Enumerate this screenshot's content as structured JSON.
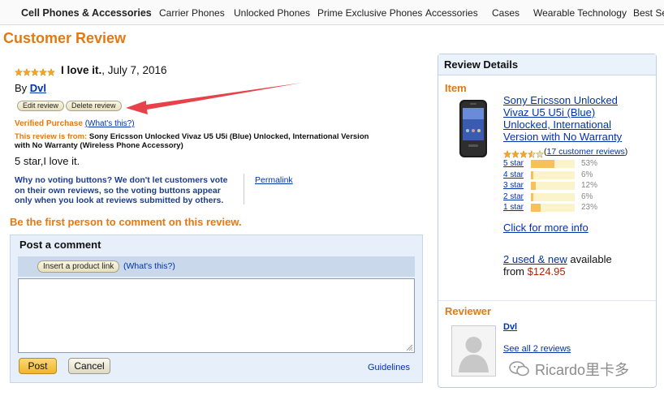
{
  "nav": {
    "items": [
      "Cell Phones & Accessories",
      "Carrier Phones",
      "Unlocked Phones",
      "Prime Exclusive Phones",
      "Accessories",
      "Cases",
      "Wearable Technology",
      "Best Se"
    ]
  },
  "page_title": "Customer Review",
  "review": {
    "rating": 5,
    "headline": "I love it.",
    "date": ", July 7, 2016",
    "by_label": "By",
    "author": "Dvl",
    "edit_label": "Edit review",
    "delete_label": "Delete review",
    "verified": "Verified Purchase",
    "whats_this": "(What's this?)",
    "from_label": "This review is from:",
    "product_name": "Sony Ericsson Unlocked Vivaz U5 U5i (Blue) Unlocked, International Version",
    "product_name_2": "with No Warranty (Wireless Phone Accessory)",
    "body": "5 star,I love it.",
    "voting_note": [
      "Why no voting buttons? We don't let customers vote",
      "on their own reviews, so the voting buttons appear",
      "only when you look at reviews submitted by others."
    ],
    "permalink": "Permalink"
  },
  "first_comment": "Be the first person to comment on this review.",
  "comment": {
    "title": "Post a comment",
    "insert_link_label": "Insert a product link",
    "whats_this": "(What's this?)",
    "textarea_value": "",
    "post_label": "Post",
    "cancel_label": "Cancel",
    "guidelines": "Guidelines"
  },
  "details": {
    "title": "Review Details",
    "item_heading": "Item",
    "product_lines": [
      "Sony Ericsson Unlocked",
      "Vivaz U5 U5i (Blue)",
      "Unlocked, International",
      "Version with No Warranty"
    ],
    "avg_rating": 3.5,
    "reviews_count_open": "(",
    "reviews_count_link": "17 customer reviews",
    "reviews_count_close": ")",
    "histogram": [
      {
        "label": "5 star",
        "pct": 53,
        "pct_text": "53%"
      },
      {
        "label": "4 star",
        "pct": 6,
        "pct_text": "6%"
      },
      {
        "label": "3 star",
        "pct": 12,
        "pct_text": "12%"
      },
      {
        "label": "2 star",
        "pct": 6,
        "pct_text": "6%"
      },
      {
        "label": "1 star",
        "pct": 23,
        "pct_text": "23%"
      }
    ],
    "more_info": "Click for more info",
    "used_new_link": "2 used & new",
    "available": " available",
    "from_label": "from ",
    "price": "$124.95",
    "reviewer_heading": "Reviewer",
    "reviewer_name": "Dvl",
    "see_all": "See all 2 reviews"
  },
  "watermark": "Ricardo里卡多",
  "colors": {
    "accent": "#e47911",
    "link": "#0033aa",
    "star": "#f5a623",
    "bar": "#f8c05a",
    "arrow": "#e8414a"
  }
}
